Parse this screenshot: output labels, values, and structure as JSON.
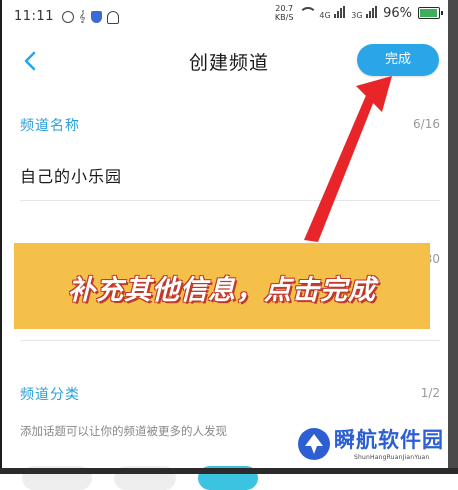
{
  "status_bar": {
    "time": "11:11",
    "net_speed_value": "20.7",
    "net_speed_unit": "KB/S",
    "signal_1": "4G",
    "signal_2": "3G",
    "battery": "96%"
  },
  "header": {
    "title": "创建频道",
    "done_label": "完成"
  },
  "channel_name": {
    "label": "频道名称",
    "counter": "6/16",
    "value": "自己的小乐园"
  },
  "channel_intro": {
    "counter_partial": "30"
  },
  "banner": {
    "text": "补充其他信息，点击完成",
    "color": "#f5c04a"
  },
  "channel_category": {
    "label": "频道分类",
    "counter": "1/2",
    "hint": "添加话题可以让你的频道被更多的人发现"
  },
  "watermark": {
    "name": "瞬航软件园",
    "sub": "ShunHangRuanJianYuan"
  },
  "colors": {
    "accent": "#2aa6e8",
    "annotation_arrow": "#e8262a"
  }
}
